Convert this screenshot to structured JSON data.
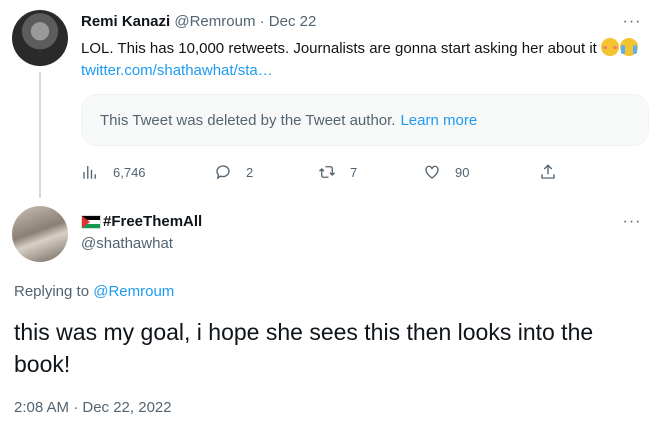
{
  "tweet1": {
    "author_name": "Remi Kanazi",
    "author_handle": "@Remroum",
    "separator": "·",
    "date": "Dec 22",
    "text": "LOL. This has 10,000 retweets. Journalists are gonna start asking her about it",
    "emojis": [
      "flushed-face",
      "crying-face"
    ],
    "link_text": "twitter.com/shathawhat/sta…",
    "quoted_deleted_text": "This Tweet was deleted by the Tweet author.",
    "learn_more_label": "Learn more",
    "stats": {
      "views": "6,746",
      "replies": "2",
      "retweets": "7",
      "likes": "90"
    },
    "icons": [
      "views-icon",
      "reply-icon",
      "retweet-icon",
      "like-icon",
      "share-icon",
      "more-icon"
    ]
  },
  "tweet2": {
    "display_name": "#FreeThemAll",
    "name_prefix_emoji": "palestine-flag",
    "handle": "@shathawhat",
    "replying_prefix": "Replying to",
    "replying_handle": "@Remroum",
    "text": "this was my goal, i hope she sees this then looks into the book!",
    "timestamp": "2:08 AM · Dec 22, 2022"
  },
  "colors": {
    "text": "#0f1419",
    "muted": "#536471",
    "link": "#1d9bf0",
    "box_bg": "#f7f9f9",
    "thread_line": "#cfd9de"
  }
}
